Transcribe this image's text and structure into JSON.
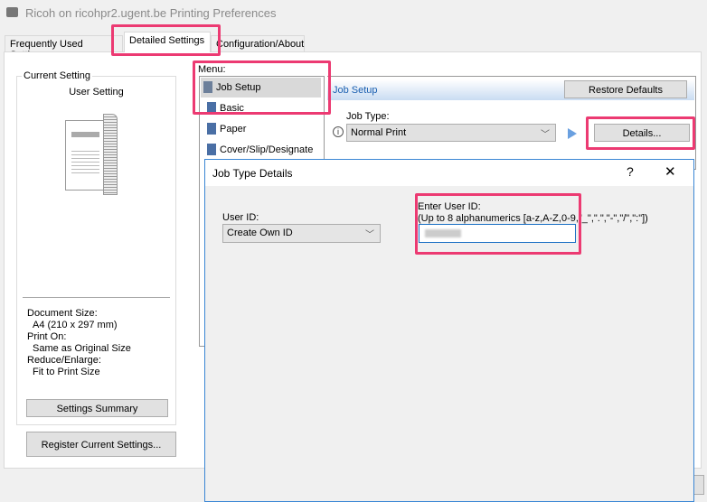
{
  "window": {
    "title": "Ricoh on ricohpr2.ugent.be Printing Preferences"
  },
  "tabs": [
    {
      "label": "Frequently Used Settings"
    },
    {
      "label": "Detailed Settings",
      "active": true
    },
    {
      "label": "Configuration/About"
    }
  ],
  "current_setting": {
    "group_label": "Current Setting",
    "name": "User Setting",
    "details": [
      {
        "label": "Document Size:",
        "value": "A4 (210 x 297 mm)"
      },
      {
        "label": "Print On:",
        "value": "Same as Original Size"
      },
      {
        "label": "Reduce/Enlarge:",
        "value": "Fit to Print Size"
      }
    ],
    "summary_button": "Settings Summary",
    "register_button": "Register Current Settings..."
  },
  "menu": {
    "label": "Menu:",
    "items": [
      {
        "label": "Job Setup",
        "selected": true
      },
      {
        "label": "Basic"
      },
      {
        "label": "Paper"
      },
      {
        "label": "Cover/Slip/Designate"
      }
    ]
  },
  "job_setup": {
    "header": "Job Setup",
    "restore_button": "Restore Defaults",
    "job_type_label": "Job Type:",
    "job_type_value": "Normal Print",
    "details_button": "Details..."
  },
  "dialog": {
    "title": "Job Type Details",
    "help": "?",
    "close": "✕",
    "user_id_label": "User ID:",
    "user_id_value": "Create Own ID",
    "enter_label": "Enter User ID:",
    "enter_hint": "(Up to 8 alphanumerics [a-z,A-Z,0-9,\"_\",\".\",\"-\",\"/\",\":\"])",
    "enter_value": ""
  },
  "colors": {
    "highlight": "#ec3a72",
    "accent": "#1a6fc4"
  }
}
